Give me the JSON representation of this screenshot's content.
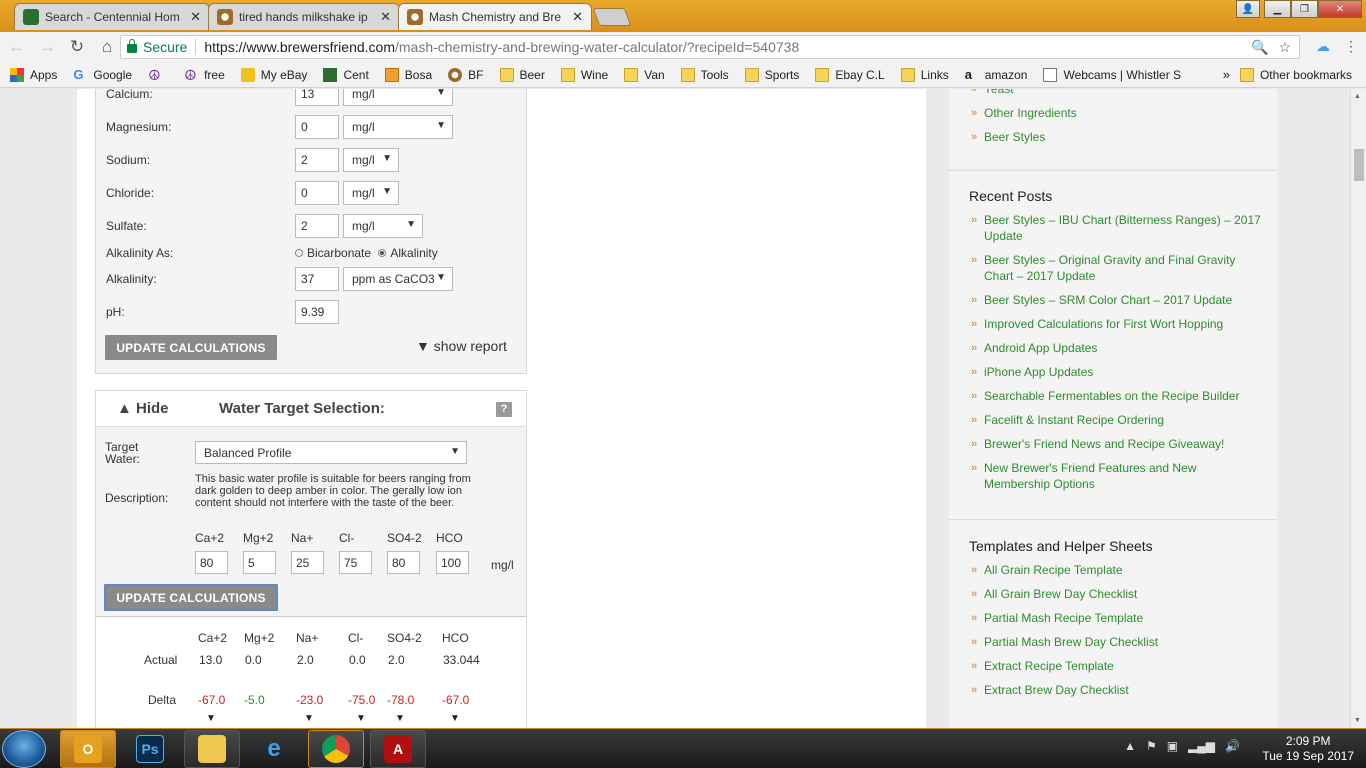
{
  "tabs": [
    {
      "title": "Search - Centennial Hom",
      "active": false
    },
    {
      "title": "tired hands milkshake ip",
      "active": false
    },
    {
      "title": "Mash Chemistry and Bre",
      "active": true
    }
  ],
  "address_bar": {
    "secure_label": "Secure",
    "url_host": "https://www.brewersfriend.com",
    "url_path": "/mash-chemistry-and-brewing-water-calculator/?recipeId=540738"
  },
  "bookmarks": [
    {
      "label": "Apps",
      "icon": "apps-grid-icon"
    },
    {
      "label": "Google",
      "icon": "google-g-icon"
    },
    {
      "label": "",
      "icon": "peace-sign-icon"
    },
    {
      "label": "free",
      "icon": "peace-sign-icon"
    },
    {
      "label": "My eBay",
      "icon": "ebay-bag-icon"
    },
    {
      "label": "Cent",
      "icon": "beer-label-icon"
    },
    {
      "label": "Bosa",
      "icon": "bosa-icon"
    },
    {
      "label": "BF",
      "icon": "beer-glass-icon"
    },
    {
      "label": "Beer",
      "icon": "folder-icon"
    },
    {
      "label": "Wine",
      "icon": "folder-icon"
    },
    {
      "label": "Van",
      "icon": "folder-icon"
    },
    {
      "label": "Tools",
      "icon": "folder-icon"
    },
    {
      "label": "Sports",
      "icon": "folder-icon"
    },
    {
      "label": "Ebay C.L",
      "icon": "folder-icon"
    },
    {
      "label": "Links",
      "icon": "folder-icon"
    },
    {
      "label": "amazon",
      "icon": "amazon-icon"
    },
    {
      "label": "Webcams | Whistler S",
      "icon": "page-icon"
    }
  ],
  "bookmarks_more": "»",
  "other_bookmarks": "Other bookmarks",
  "source_water": {
    "rows": [
      {
        "label": "Calcium:",
        "value": "13",
        "unit": "mg/l"
      },
      {
        "label": "Magnesium:",
        "value": "0",
        "unit": "mg/l"
      },
      {
        "label": "Sodium:",
        "value": "2",
        "unit": "mg/l"
      },
      {
        "label": "Chloride:",
        "value": "0",
        "unit": "mg/l"
      },
      {
        "label": "Sulfate:",
        "value": "2",
        "unit": "mg/l"
      }
    ],
    "alkalinity_as_label": "Alkalinity As:",
    "alkalinity_as_options": [
      "Bicarbonate",
      "Alkalinity"
    ],
    "alkalinity_label": "Alkalinity:",
    "alkalinity_value": "37",
    "alkalinity_unit": "ppm as CaCO3",
    "ph_label": "pH:",
    "ph_value": "9.39",
    "update_button": "UPDATE CALCULATIONS",
    "show_report": "▼ show report"
  },
  "water_target": {
    "hide_label": "▲ Hide",
    "title": "Water Target Selection:",
    "help": "?",
    "target_label": "Target Water:",
    "target_value": "Balanced Profile",
    "description_label": "Description:",
    "description": "This basic water profile is suitable for beers ranging from dark golden to deep amber in color. The gerally low ion content should not interfere with the taste of the beer.",
    "ions": [
      "Ca+2",
      "Mg+2",
      "Na+",
      "Cl-",
      "SO4-2",
      "HCO"
    ],
    "ion_values": [
      "80",
      "5",
      "25",
      "75",
      "80",
      "100"
    ],
    "unit": "mg/l",
    "update_button": "UPDATE CALCULATIONS"
  },
  "results": {
    "ions": [
      "Ca+2",
      "Mg+2",
      "Na+",
      "Cl-",
      "SO4-2",
      "HCO"
    ],
    "actual_label": "Actual",
    "actual": [
      "13.0",
      "0.0",
      "2.0",
      "0.0",
      "2.0",
      "33.044"
    ],
    "delta_label": "Delta",
    "delta": [
      "-67.0",
      "-5.0",
      "-23.0",
      "-75.0",
      "-78.0",
      "-67.0"
    ],
    "delta_status": [
      "red",
      "green",
      "red",
      "red",
      "red",
      "red"
    ],
    "arrows": [
      "▼",
      "",
      "▼",
      "▼",
      "▼",
      "▼"
    ]
  },
  "sidebar": {
    "top_links": [
      "Yeast",
      "Other Ingredients",
      "Beer Styles"
    ],
    "recent_posts_title": "Recent Posts",
    "recent_posts": [
      "Beer Styles – IBU Chart (Bitterness Ranges) – 2017 Update",
      "Beer Styles – Original Gravity and Final Gravity Chart – 2017 Update",
      "Beer Styles – SRM Color Chart – 2017 Update",
      "Improved Calculations for First Wort Hopping",
      "Android App Updates",
      "iPhone App Updates",
      "Searchable Fermentables on the Recipe Builder",
      "Facelift & Instant Recipe Ordering",
      "Brewer's Friend News and Recipe Giveaway!",
      "New Brewer's Friend Features and New Membership Options"
    ],
    "templates_title": "Templates and Helper Sheets",
    "templates": [
      "All Grain Recipe Template",
      "All Grain Brew Day Checklist",
      "Partial Mash Recipe Template",
      "Partial Mash Brew Day Checklist",
      "Extract Recipe Template",
      "Extract Brew Day Checklist"
    ]
  },
  "taskbar": {
    "apps": [
      "outlook-icon",
      "photoshop-icon",
      "file-explorer-icon",
      "internet-explorer-icon",
      "chrome-icon",
      "acrobat-icon"
    ],
    "time": "2:09 PM",
    "date": "Tue 19 Sep 2017"
  },
  "colors": {
    "link_green": "#2f8c2f",
    "delta_red": "#d12020",
    "button_gray": "#8a8a8a",
    "chrome_orange": "#d9901a"
  }
}
